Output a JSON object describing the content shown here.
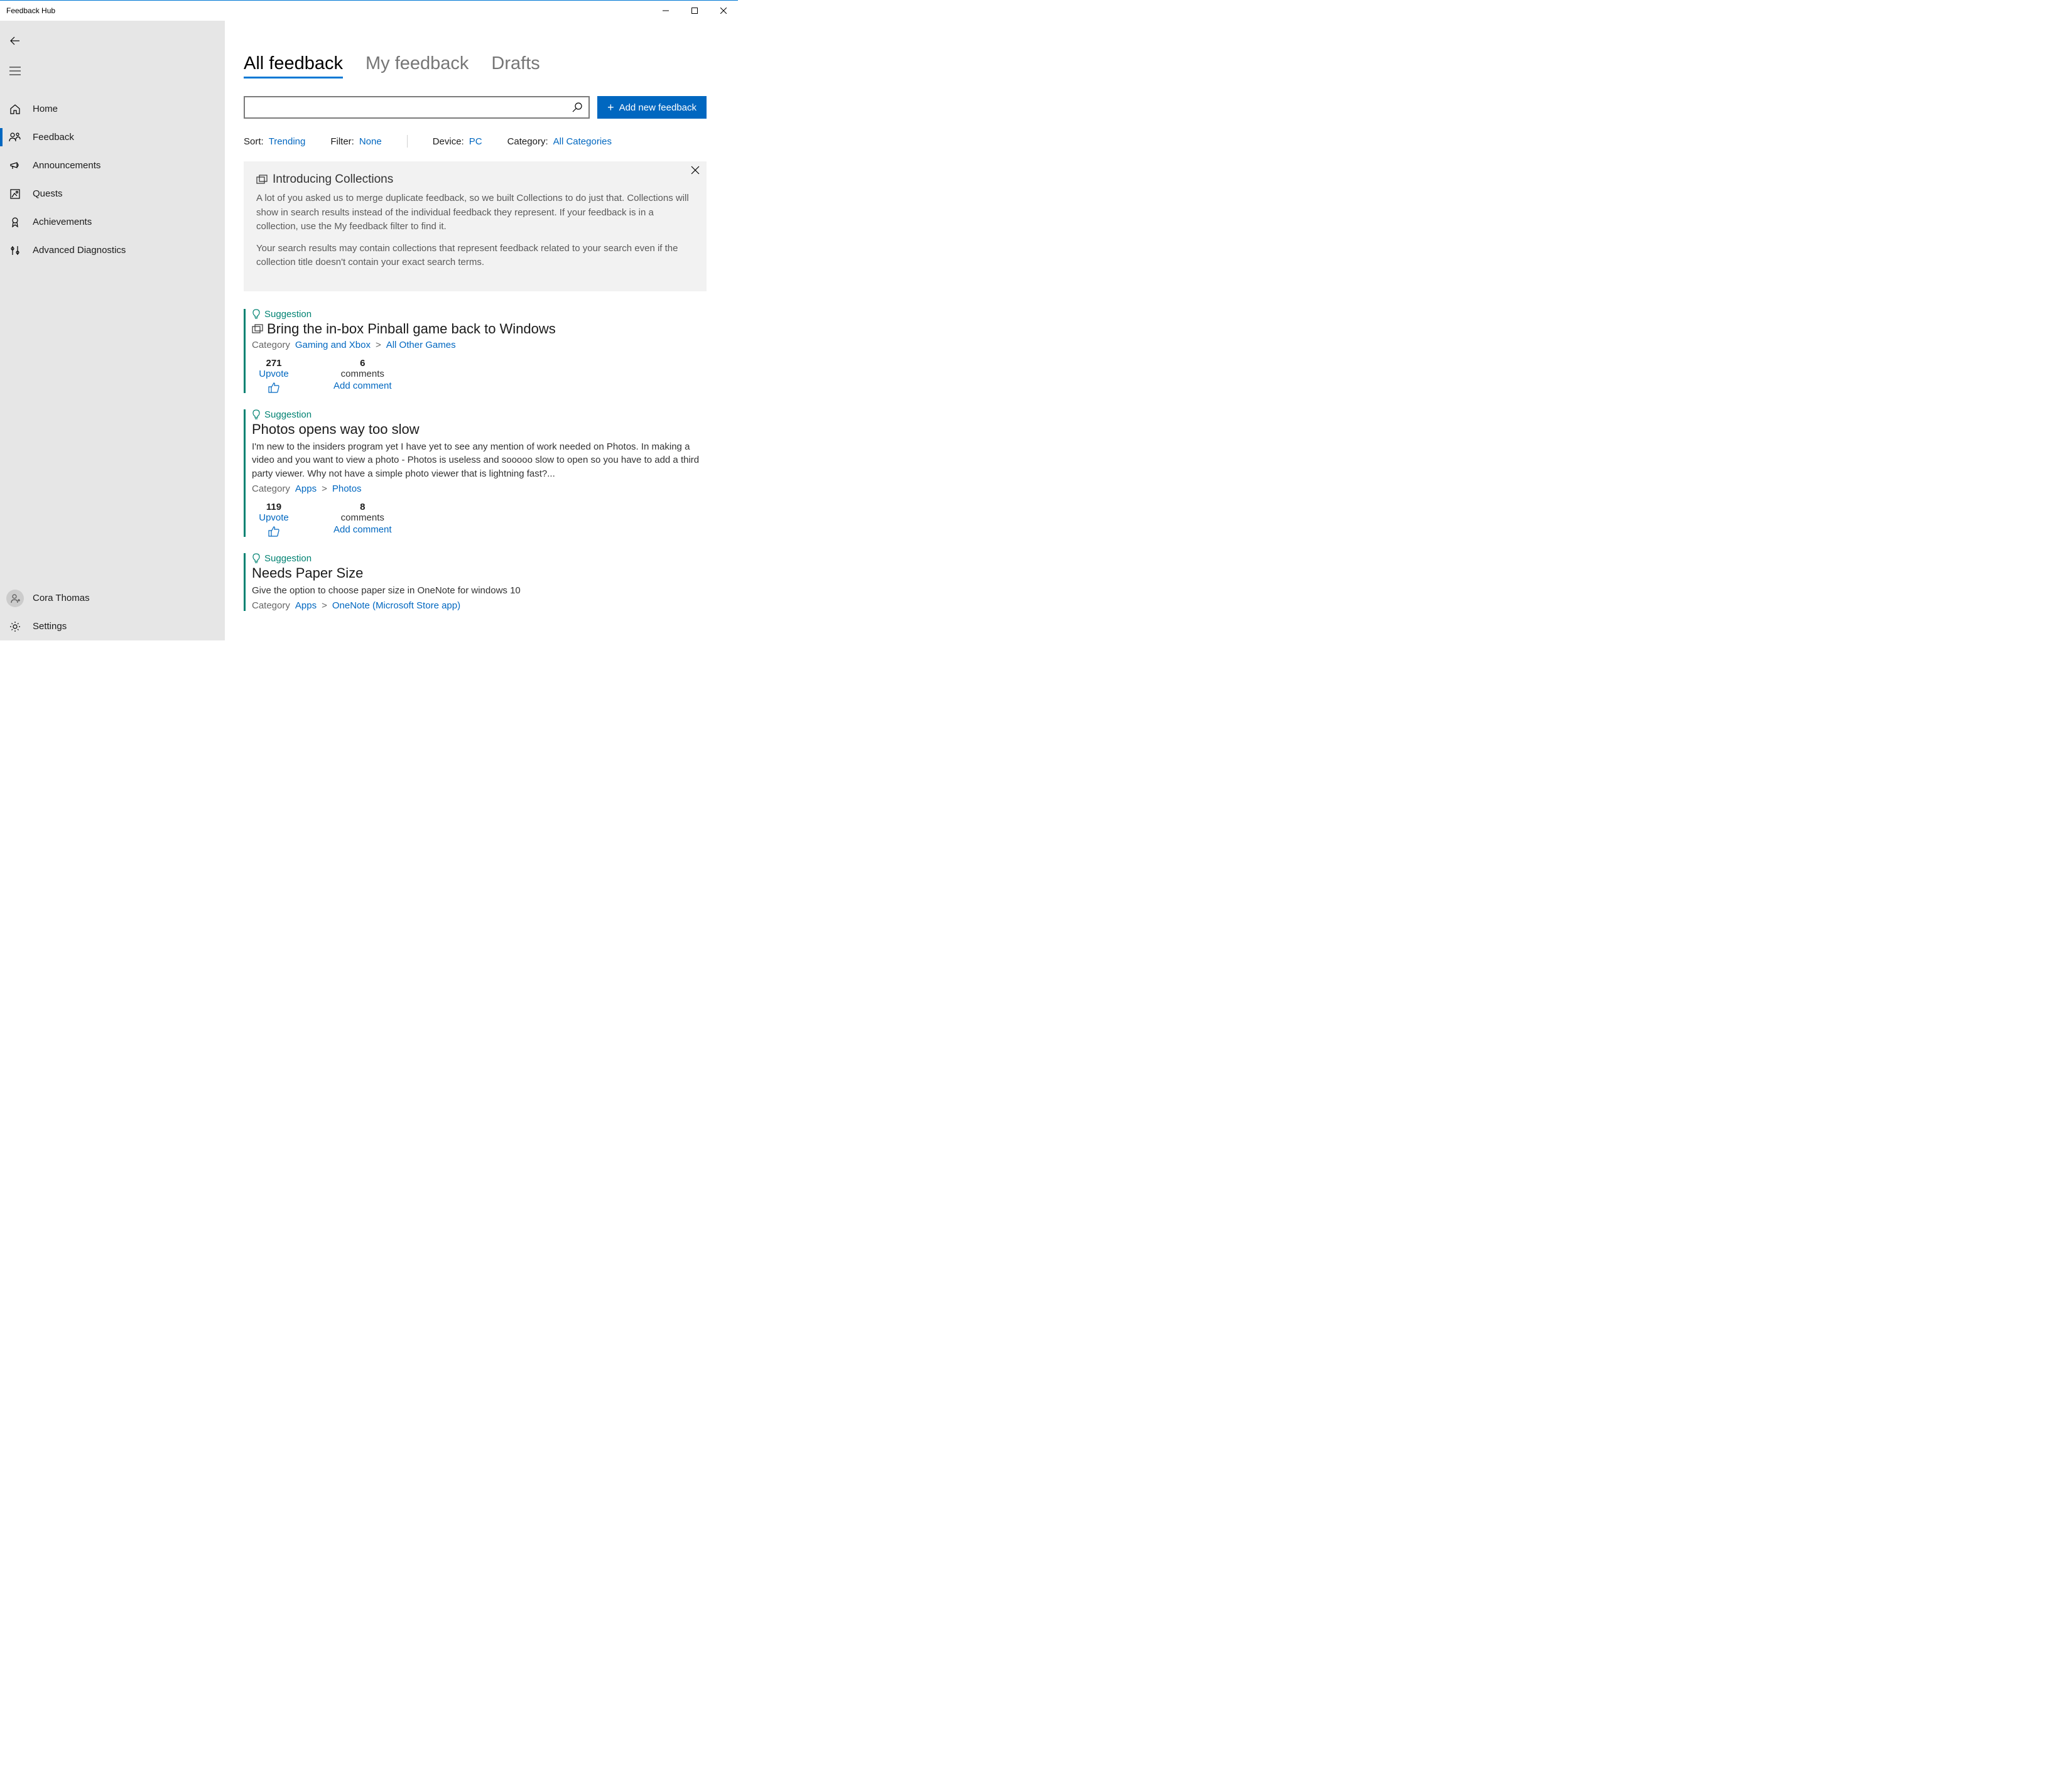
{
  "titlebar": {
    "title": "Feedback Hub"
  },
  "sidebar": {
    "items": [
      {
        "label": "Home"
      },
      {
        "label": "Feedback"
      },
      {
        "label": "Announcements"
      },
      {
        "label": "Quests"
      },
      {
        "label": "Achievements"
      },
      {
        "label": "Advanced Diagnostics"
      }
    ],
    "user": "Cora Thomas",
    "settings": "Settings"
  },
  "tabs": {
    "all": "All feedback",
    "my": "My feedback",
    "drafts": "Drafts"
  },
  "toolbar": {
    "add_label": "Add new feedback"
  },
  "filters": {
    "sort_label": "Sort:",
    "sort_value": "Trending",
    "filter_label": "Filter:",
    "filter_value": "None",
    "device_label": "Device:",
    "device_value": "PC",
    "category_label": "Category:",
    "category_value": "All Categories"
  },
  "banner": {
    "title": "Introducing Collections",
    "p1": "A lot of you asked us to merge duplicate feedback, so we built Collections to do just that. Collections will show in search results instead of the individual feedback they represent. If your feedback is in a collection, use the My feedback filter to find it.",
    "p2": "Your search results may contain collections that represent feedback related to your search even if the collection title doesn't contain your exact search terms."
  },
  "items": [
    {
      "tag": "Suggestion",
      "collection": true,
      "title": "Bring the in-box Pinball game back to Windows",
      "cat_label": "Category",
      "cat1": "Gaming and Xbox",
      "cat2": "All Other Games",
      "upvotes": "271",
      "upvote_label": "Upvote",
      "comments": "6",
      "comments_label": "comments",
      "add_comment": "Add comment"
    },
    {
      "tag": "Suggestion",
      "collection": false,
      "title": "Photos opens way too slow",
      "body": "I'm new to the insiders program yet I have yet to see any mention of work needed on Photos.  In making a video and you want to view a photo - Photos is useless and sooooo slow to open so you have to add a third party viewer.  Why not have a simple photo viewer that is lightning fast?...",
      "cat_label": "Category",
      "cat1": "Apps",
      "cat2": "Photos",
      "upvotes": "119",
      "upvote_label": "Upvote",
      "comments": "8",
      "comments_label": "comments",
      "add_comment": "Add comment"
    },
    {
      "tag": "Suggestion",
      "collection": false,
      "title": "Needs Paper Size",
      "body": "Give the option to choose paper size in OneNote for windows 10",
      "cat_label": "Category",
      "cat1": "Apps",
      "cat2": "OneNote (Microsoft Store app)"
    }
  ]
}
